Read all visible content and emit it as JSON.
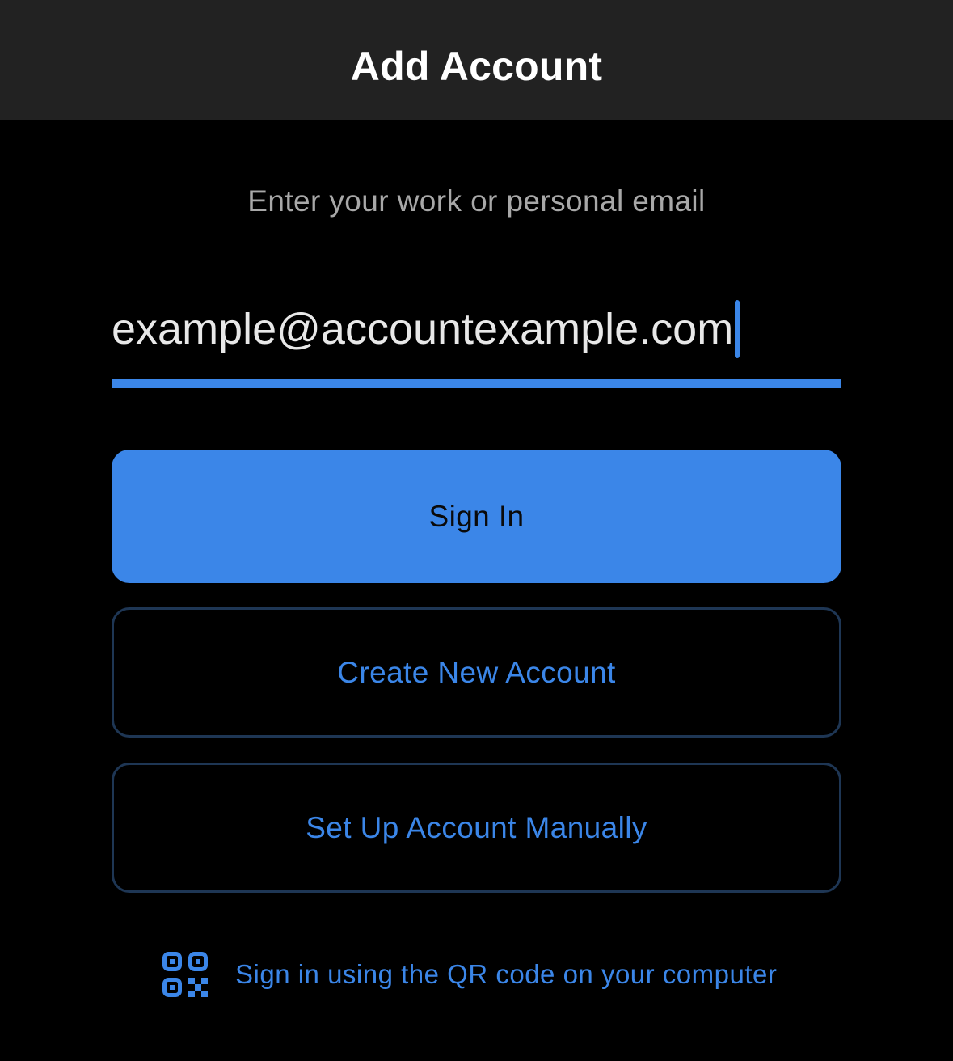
{
  "header": {
    "title": "Add Account"
  },
  "form": {
    "prompt": "Enter your work or personal email",
    "email_value": "example@accountexample.com"
  },
  "actions": {
    "sign_in_label": "Sign In",
    "create_account_label": "Create New Account",
    "manual_setup_label": "Set Up Account Manually"
  },
  "qr": {
    "icon": "qr-code-icon",
    "label": "Sign in using the QR code on your computer"
  },
  "colors": {
    "accent": "#3b86e8",
    "background": "#000000",
    "nav_background": "#222222",
    "outline_border": "#1e3654",
    "prompt_text": "#a8a8a8"
  }
}
